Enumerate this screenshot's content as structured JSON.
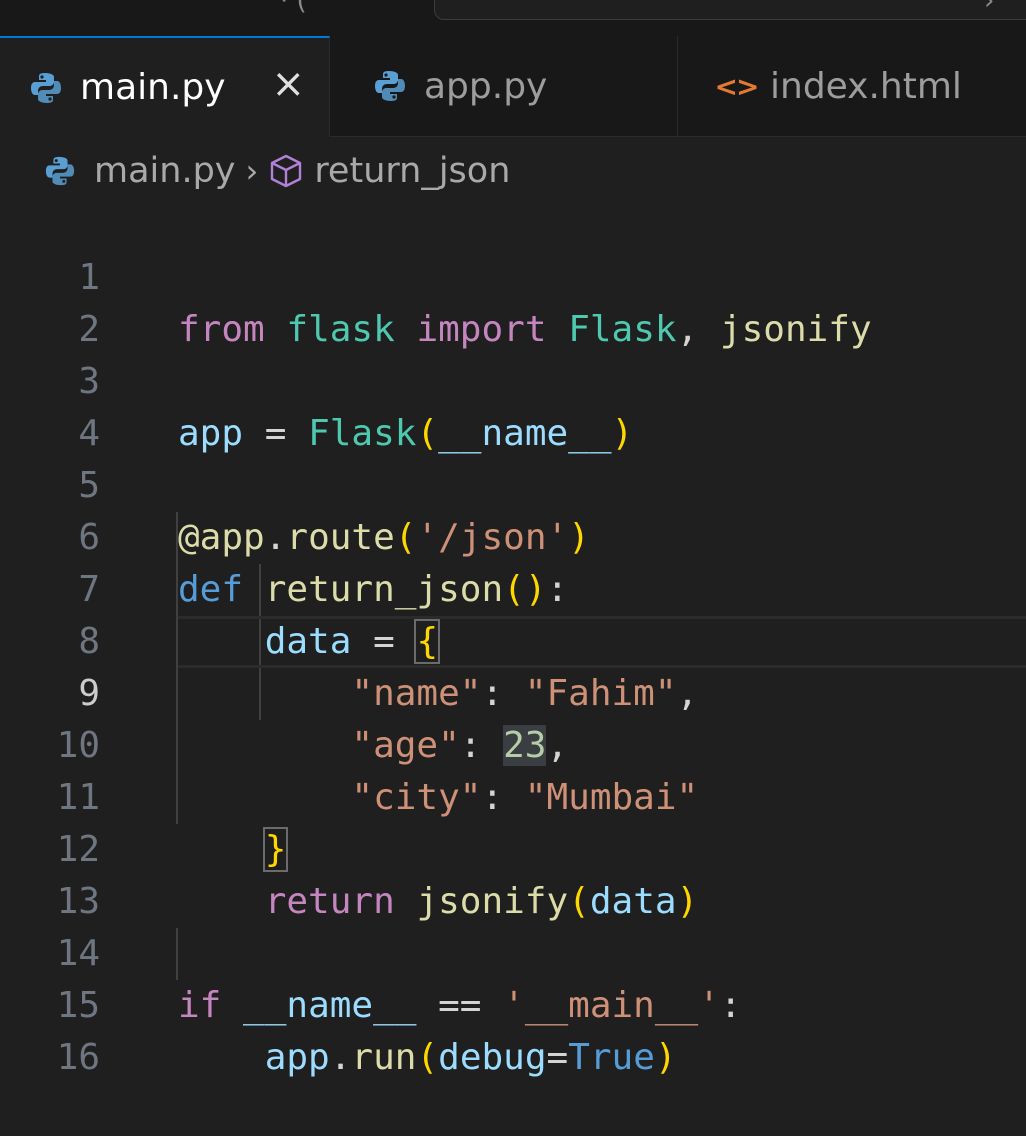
{
  "titlebar": {
    "fragment": "· (",
    "chevron": "›"
  },
  "tabs": [
    {
      "label": "main.py",
      "icon": "python-icon",
      "active": true,
      "close": "×"
    },
    {
      "label": "app.py",
      "icon": "python-icon",
      "active": false
    },
    {
      "label": "index.html",
      "icon": "html-brackets-icon",
      "active": false
    }
  ],
  "breadcrumb": {
    "file": "main.py",
    "separator": "›",
    "symbol": "return_json",
    "symbol_icon": "cube-icon"
  },
  "editor": {
    "current_line": 9,
    "line_numbers": [
      "1",
      "2",
      "3",
      "4",
      "5",
      "6",
      "7",
      "8",
      "9",
      "10",
      "11",
      "12",
      "13",
      "14",
      "15",
      "16"
    ],
    "lines": {
      "l1": {
        "t1": "from",
        "t2": " ",
        "t3": "flask",
        "t4": " ",
        "t5": "import",
        "t6": " ",
        "t7": "Flask",
        "t8": ", ",
        "t9": "jsonify"
      },
      "l3": {
        "t1": "app",
        "t2": " = ",
        "t3": "Flask",
        "t4": "(",
        "t5": "__name__",
        "t6": ")"
      },
      "l5": {
        "t1": "@app",
        "t2": ".",
        "t3": "route",
        "t4": "(",
        "t5": "'/json'",
        "t6": ")"
      },
      "l6": {
        "t1": "def",
        "t2": " ",
        "t3": "return_json",
        "t4": "()",
        "t5": ":"
      },
      "l7": {
        "t1": "    ",
        "t2": "data",
        "t3": " = ",
        "t4": "{"
      },
      "l8": {
        "t1": "        ",
        "t2": "\"name\"",
        "t3": ": ",
        "t4": "\"Fahim\"",
        "t5": ","
      },
      "l9": {
        "t1": "        ",
        "t2": "\"age\"",
        "t3": ": ",
        "t4": "23",
        "t5": ","
      },
      "l10": {
        "t1": "        ",
        "t2": "\"city\"",
        "t3": ": ",
        "t4": "\"Mumbai\""
      },
      "l11": {
        "t1": "    ",
        "t2": "}"
      },
      "l12": {
        "t1": "    ",
        "t2": "return",
        "t3": " ",
        "t4": "jsonify",
        "t5": "(",
        "t6": "data",
        "t7": ")"
      },
      "l14": {
        "t1": "if",
        "t2": " ",
        "t3": "__name__",
        "t4": " == ",
        "t5": "'__main__'",
        "t6": ":"
      },
      "l15": {
        "t1": "    ",
        "t2": "app",
        "t3": ".",
        "t4": "run",
        "t5": "(",
        "t6": "debug",
        "t7": "=",
        "t8": "True",
        "t9": ")"
      }
    }
  },
  "colors": {
    "background": "#1f1f1f",
    "keyword": "#c586c0",
    "keyword_blue": "#569cd6",
    "module": "#4ec9b0",
    "function": "#dcdcaa",
    "variable": "#9cdcfe",
    "string": "#ce9178",
    "number": "#b5cea8",
    "active_tab_border": "#0078d4"
  }
}
